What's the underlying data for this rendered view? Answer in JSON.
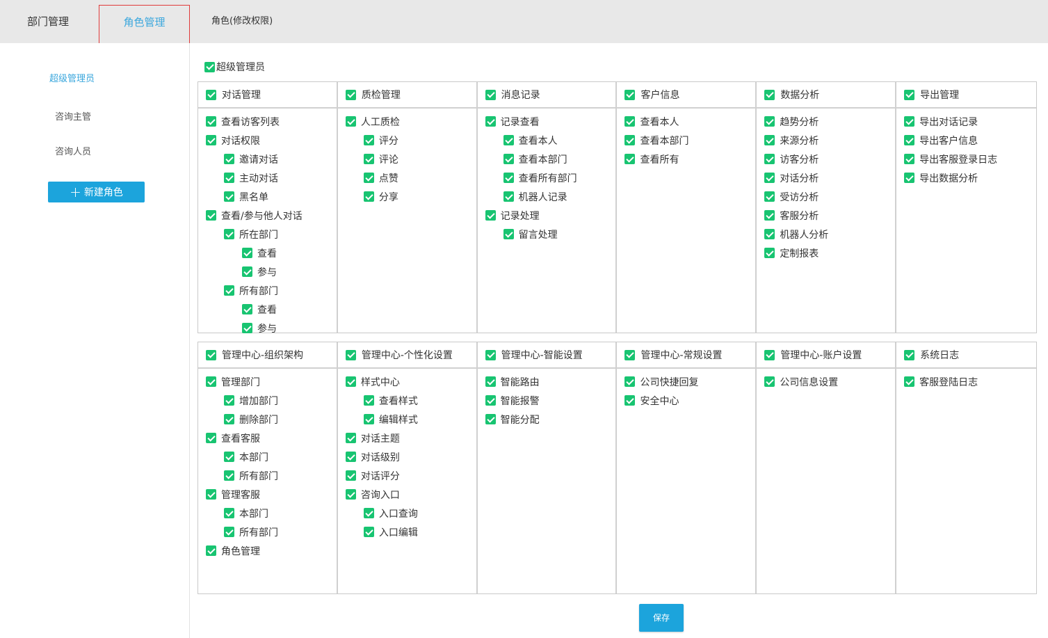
{
  "tabs": {
    "dept": "部门管理",
    "role": "角色管理",
    "role_edit": "角色(修改权限)"
  },
  "sidebar": {
    "roles": [
      "超级管理员",
      "咨询主管",
      "咨询人员"
    ],
    "new_role": "新建角色"
  },
  "main": {
    "super_admin": "超级管理员",
    "panel1": [
      {
        "head": "对话管理",
        "items": [
          {
            "label": "查看访客列表",
            "level": 0
          },
          {
            "label": "对话权限",
            "level": 0
          },
          {
            "label": "邀请对话",
            "level": 1
          },
          {
            "label": "主动对话",
            "level": 1
          },
          {
            "label": "黑名单",
            "level": 1
          },
          {
            "label": "查看/参与他人对话",
            "level": 0
          },
          {
            "label": "所在部门",
            "level": 1
          },
          {
            "label": "查看",
            "level": 2
          },
          {
            "label": "参与",
            "level": 2
          },
          {
            "label": "所有部门",
            "level": 1
          },
          {
            "label": "查看",
            "level": 2
          },
          {
            "label": "参与",
            "level": 2
          }
        ]
      },
      {
        "head": "质检管理",
        "items": [
          {
            "label": "人工质检",
            "level": 0
          },
          {
            "label": "评分",
            "level": 1
          },
          {
            "label": "评论",
            "level": 1
          },
          {
            "label": "点赞",
            "level": 1
          },
          {
            "label": "分享",
            "level": 1
          }
        ]
      },
      {
        "head": "消息记录",
        "items": [
          {
            "label": "记录查看",
            "level": 0
          },
          {
            "label": "查看本人",
            "level": 1
          },
          {
            "label": "查看本部门",
            "level": 1
          },
          {
            "label": "查看所有部门",
            "level": 1
          },
          {
            "label": "机器人记录",
            "level": 1
          },
          {
            "label": "记录处理",
            "level": 0
          },
          {
            "label": "留言处理",
            "level": 1
          }
        ]
      },
      {
        "head": "客户信息",
        "items": [
          {
            "label": "查看本人",
            "level": 0
          },
          {
            "label": "查看本部门",
            "level": 0
          },
          {
            "label": "查看所有",
            "level": 0
          }
        ]
      },
      {
        "head": "数据分析",
        "items": [
          {
            "label": "趋势分析",
            "level": 0
          },
          {
            "label": "来源分析",
            "level": 0
          },
          {
            "label": "访客分析",
            "level": 0
          },
          {
            "label": "对话分析",
            "level": 0
          },
          {
            "label": "受访分析",
            "level": 0
          },
          {
            "label": "客服分析",
            "level": 0
          },
          {
            "label": "机器人分析",
            "level": 0
          },
          {
            "label": "定制报表",
            "level": 0
          }
        ]
      },
      {
        "head": "导出管理",
        "items": [
          {
            "label": "导出对话记录",
            "level": 0
          },
          {
            "label": "导出客户信息",
            "level": 0
          },
          {
            "label": "导出客服登录日志",
            "level": 0
          },
          {
            "label": "导出数据分析",
            "level": 0
          }
        ]
      }
    ],
    "panel2": [
      {
        "head": "管理中心-组织架构",
        "items": [
          {
            "label": "管理部门",
            "level": 0
          },
          {
            "label": "增加部门",
            "level": 1
          },
          {
            "label": "删除部门",
            "level": 1
          },
          {
            "label": "查看客服",
            "level": 0
          },
          {
            "label": "本部门",
            "level": 1
          },
          {
            "label": "所有部门",
            "level": 1
          },
          {
            "label": "管理客服",
            "level": 0
          },
          {
            "label": "本部门",
            "level": 1
          },
          {
            "label": "所有部门",
            "level": 1
          },
          {
            "label": "角色管理",
            "level": 0
          }
        ]
      },
      {
        "head": "管理中心-个性化设置",
        "items": [
          {
            "label": "样式中心",
            "level": 0
          },
          {
            "label": "查看样式",
            "level": 1
          },
          {
            "label": "编辑样式",
            "level": 1
          },
          {
            "label": "对话主题",
            "level": 0
          },
          {
            "label": "对话级别",
            "level": 0
          },
          {
            "label": "对话评分",
            "level": 0
          },
          {
            "label": "咨询入口",
            "level": 0
          },
          {
            "label": "入口查询",
            "level": 1
          },
          {
            "label": "入口编辑",
            "level": 1
          }
        ]
      },
      {
        "head": "管理中心-智能设置",
        "items": [
          {
            "label": "智能路由",
            "level": 0
          },
          {
            "label": "智能报警",
            "level": 0
          },
          {
            "label": "智能分配",
            "level": 0
          }
        ]
      },
      {
        "head": "管理中心-常规设置",
        "items": [
          {
            "label": "公司快捷回复",
            "level": 0
          },
          {
            "label": "安全中心",
            "level": 0
          }
        ]
      },
      {
        "head": "管理中心-账户设置",
        "items": [
          {
            "label": "公司信息设置",
            "level": 0
          }
        ]
      },
      {
        "head": "系统日志",
        "items": [
          {
            "label": "客服登陆日志",
            "level": 0
          }
        ]
      }
    ],
    "save": "保存"
  }
}
